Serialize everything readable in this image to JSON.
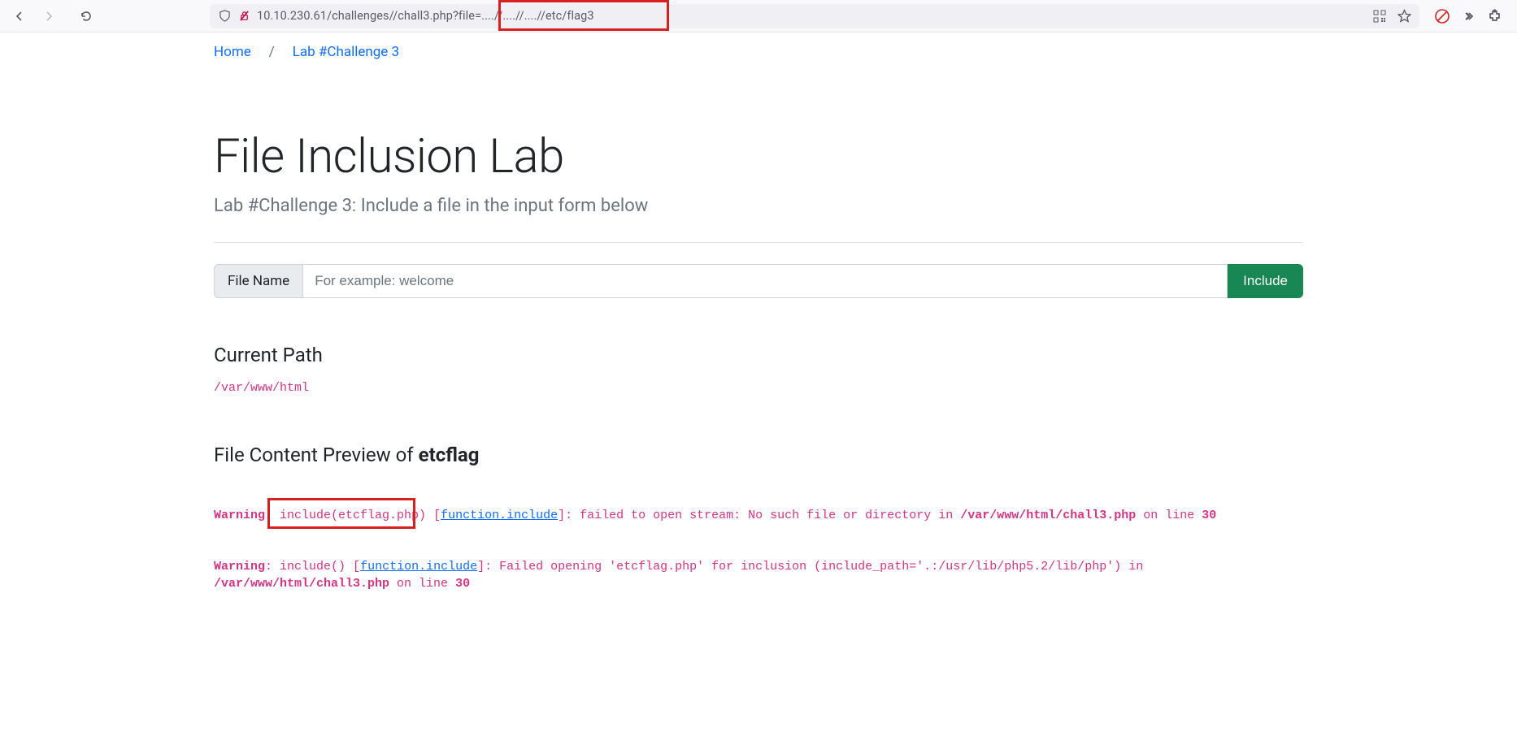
{
  "browser": {
    "url_text": "10.10.230.61/challenges//chall3.php?file=....//....//....//etc/flag3"
  },
  "breadcrumb": {
    "home": "Home",
    "sep": "/",
    "lab": "Lab #Challenge 3"
  },
  "title": "File Inclusion Lab",
  "subtitle": "Lab #Challenge 3: Include a file in the input form below",
  "form": {
    "label": "File Name",
    "placeholder": "For example: welcome",
    "button": "Include"
  },
  "current_path_heading": "Current Path",
  "current_path_value": "/var/www/html",
  "preview": {
    "prefix": "File Content Preview of ",
    "filename": "etcflag"
  },
  "warning1": {
    "warning": "Warning",
    "colon": ": ",
    "include_call": "include(etcflag.php)",
    "open_bracket": " [",
    "link_text": "function.include",
    "close_bracket": "]: ",
    "msg": "failed to open stream: No such file or directory in ",
    "path": "/var/www/html/chall3.php",
    "on_line": " on line ",
    "line_no": "30"
  },
  "warning2": {
    "warning": "Warning",
    "colon": ": ",
    "include_call": "include() [",
    "link_text": "function.include",
    "close_bracket": "]: ",
    "msg_a": "Failed opening 'etcflag.php' for inclusion (include_path='.:/usr/lib/php5.2/lib/php') in ",
    "path": "/var/www/html/chall3.php",
    "on_line": " on line ",
    "line_no": "30"
  }
}
